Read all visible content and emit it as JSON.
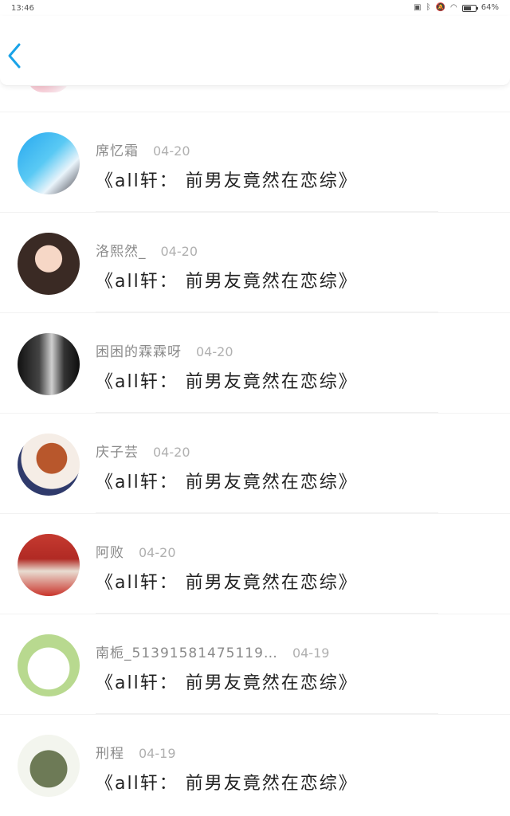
{
  "status_bar": {
    "time": "13:46",
    "icons": [
      "vibrate-icon",
      "bluetooth-icon",
      "mute-icon",
      "wifi-icon",
      "battery-icon"
    ],
    "battery_percent": 64,
    "battery_label": "64%"
  },
  "header": {
    "back_icon": "chevron-left-icon",
    "accent_color": "#1aa3e8"
  },
  "comments": [
    {
      "name": "席忆霜",
      "date": "04-20",
      "message": "《all轩： 前男友竟然在恋综》"
    },
    {
      "name": "洛熙然_",
      "date": "04-20",
      "message": "《all轩： 前男友竟然在恋综》"
    },
    {
      "name": "困困的霖霖呀",
      "date": "04-20",
      "message": "《all轩： 前男友竟然在恋综》"
    },
    {
      "name": "庆子芸",
      "date": "04-20",
      "message": "《all轩： 前男友竟然在恋综》"
    },
    {
      "name": "阿败",
      "date": "04-20",
      "message": "《all轩： 前男友竟然在恋综》"
    },
    {
      "name": "南栀_51391581475119…",
      "date": "04-19",
      "message": "《all轩： 前男友竟然在恋综》"
    },
    {
      "name": "刑程",
      "date": "04-19",
      "message": "《all轩： 前男友竟然在恋综》"
    }
  ]
}
